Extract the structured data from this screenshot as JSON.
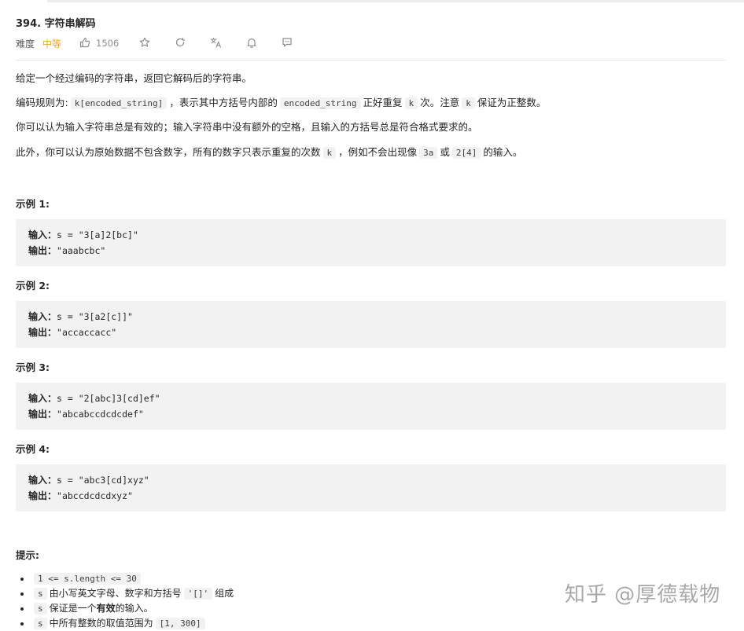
{
  "problem": {
    "title": "394. 字符串解码",
    "difficulty_label": "难度",
    "difficulty": "中等",
    "likes": "1506"
  },
  "description": [
    "给定一个经过编码的字符串，返回它解码后的字符串。"
  ],
  "rule": {
    "prefix": "编码规则为:",
    "code1": "k[encoded_string]",
    "mid1": "，表示其中方括号内部的",
    "code2": "encoded_string",
    "mid2": "正好重复",
    "code3": "k",
    "mid3": "次。注意",
    "code4": "k",
    "suffix": "保证为正整数。"
  },
  "para3": "你可以认为输入字符串总是有效的；输入字符串中没有额外的空格，且输入的方括号总是符合格式要求的。",
  "para4": {
    "prefix": "此外，你可以认为原始数据不包含数字，所有的数字只表示重复的次数",
    "code1": "k",
    "mid1": "，例如不会出现像",
    "code2": "3a",
    "mid2": "或",
    "code3": "2[4]",
    "suffix": "的输入。"
  },
  "examples": [
    {
      "heading": "示例 1:",
      "input_label": "输入：",
      "input": "s = \"3[a]2[bc]\"",
      "output_label": "输出：",
      "output": "\"aaabcbc\""
    },
    {
      "heading": "示例 2:",
      "input_label": "输入：",
      "input": "s = \"3[a2[c]]\"",
      "output_label": "输出：",
      "output": "\"accaccacc\""
    },
    {
      "heading": "示例 3:",
      "input_label": "输入：",
      "input": "s = \"2[abc]3[cd]ef\"",
      "output_label": "输出：",
      "output": "\"abcabccdcdcdef\""
    },
    {
      "heading": "示例 4:",
      "input_label": "输入：",
      "input": "s = \"abc3[cd]xyz\"",
      "output_label": "输出：",
      "output": "\"abccdcdcdxyz\""
    }
  ],
  "hints": {
    "heading": "提示:",
    "h1_code": "1 <= s.length <= 30",
    "h2_code": "s",
    "h2_text": "由小写英文字母、数字和方括号",
    "h2_code2": "'[]'",
    "h2_suffix": "组成",
    "h3_code": "s",
    "h3_text": "保证是一个",
    "h3_bold": "有效",
    "h3_suffix": "的输入。",
    "h4_code": "s",
    "h4_text": "中所有整数的取值范围为",
    "h4_code2": "[1, 300]"
  },
  "watermark": "知乎 @厚德载物",
  "icons": [
    "thumbs-up-icon",
    "star-icon",
    "share-icon",
    "translate-icon",
    "bell-icon",
    "comment-icon"
  ]
}
